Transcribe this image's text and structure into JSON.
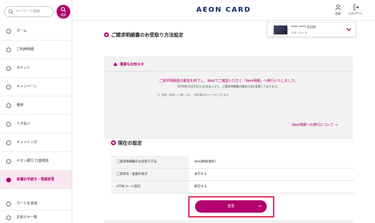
{
  "search": {
    "placeholder": "キーワード検索",
    "button_label": "検索"
  },
  "sidebar": {
    "items": [
      {
        "label": "ホーム",
        "active": false
      },
      {
        "label": "ご利用明細",
        "active": false
      },
      {
        "label": "ポイント",
        "active": false
      },
      {
        "label": "キャンペーン",
        "active": false
      },
      {
        "label": "優待",
        "active": false
      },
      {
        "label": "リボ払い",
        "active": false
      },
      {
        "label": "キャッシング",
        "active": false
      },
      {
        "label": "イオン銀行 口座残高",
        "active": false
      },
      {
        "label": "各種お手続き・登録変更",
        "active": true
      }
    ],
    "bottom_items": [
      {
        "label": "カードを追加"
      },
      {
        "label": "お知らせ一覧"
      }
    ]
  },
  "header": {
    "brand": "AEON CARD",
    "account_label": "会員",
    "logout_label": "ログアウト"
  },
  "card_selector": {
    "number": "**** **** 0100",
    "type": "イオンカード"
  },
  "page": {
    "title": "ご請求明細書のお受取り方法設定"
  },
  "notice": {
    "heading": "重要なお知らせ",
    "body1": "ご請求明細書の郵送を終了し、Webでご確認いただく「Web明細」へ移行いたしました。",
    "body2": "2019年11月5日(火)お支払いより、ご請求明細書の確認方法を変更しております。",
    "note": "※「郵送（有料）」に関しては、一部対象外のカードがございます。",
    "link": "Web明細への移行について →"
  },
  "current_settings": {
    "title": "現在の設定",
    "rows": [
      {
        "key": "ご請求明細書のお受取り方法",
        "value": "Web明細(無料)"
      },
      {
        "key": "ご請求日・金額の表示",
        "value": "表示する"
      },
      {
        "key": "HTMLメール配信",
        "value": "配信する"
      }
    ]
  },
  "change_button": {
    "label": "変更",
    "arrow": "→"
  },
  "colors": {
    "accent": "#b0006d",
    "brand": "#0b2c6a",
    "highlight": "#e0305a"
  }
}
